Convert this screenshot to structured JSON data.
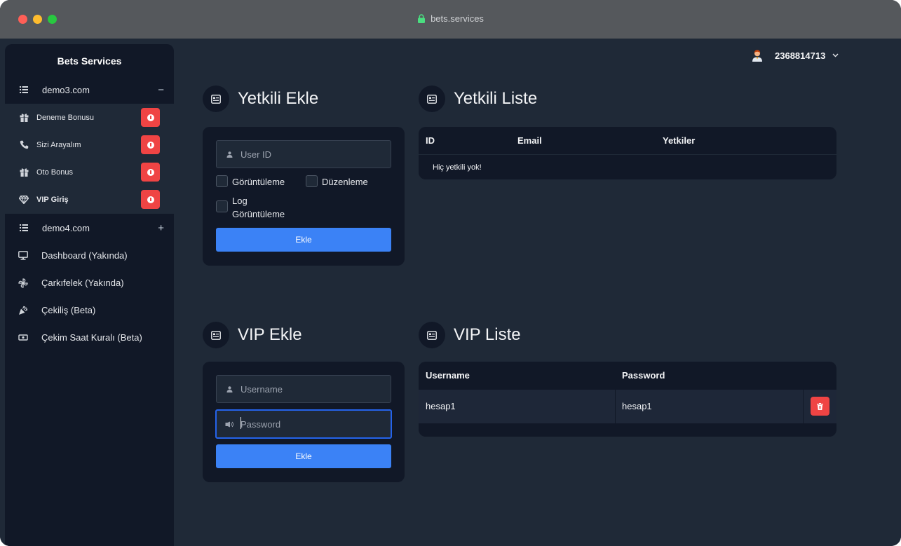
{
  "browser": {
    "url": "bets.services"
  },
  "sidebar": {
    "brand": "Bets Services",
    "site1": {
      "label": "demo3.com",
      "toggle": "−"
    },
    "site1_items": [
      {
        "label": "Deneme Bonusu",
        "icon": "gift-icon"
      },
      {
        "label": "Sizi Arayalım",
        "icon": "phone-icon"
      },
      {
        "label": "Oto Bonus",
        "icon": "gift-icon"
      },
      {
        "label": "VIP Giriş",
        "icon": "diamond-icon"
      }
    ],
    "site2": {
      "label": "demo4.com",
      "toggle": "+"
    },
    "menu": [
      {
        "label": "Dashboard (Yakında)",
        "icon": "monitor-icon"
      },
      {
        "label": "Çarkıfelek (Yakında)",
        "icon": "pinwheel-icon"
      },
      {
        "label": "Çekiliş (Beta)",
        "icon": "party-popper-icon"
      },
      {
        "label": "Çekim Saat Kuralı (Beta)",
        "icon": "money-icon"
      }
    ]
  },
  "header": {
    "user_id": "2368814713"
  },
  "yetkili_ekle": {
    "title": "Yetkili Ekle",
    "user_id_placeholder": "User ID",
    "perm_view": "Görüntüleme",
    "perm_edit": "Düzenleme",
    "perm_log_line1": "Log",
    "perm_log_line2": "Görüntüleme",
    "submit": "Ekle"
  },
  "yetkili_liste": {
    "title": "Yetkili Liste",
    "columns": [
      "ID",
      "Email",
      "Yetkiler"
    ],
    "empty": "Hiç yetkili yok!"
  },
  "vip_ekle": {
    "title": "VIP Ekle",
    "username_placeholder": "Username",
    "password_placeholder": "Password",
    "submit": "Ekle"
  },
  "vip_liste": {
    "title": "VIP Liste",
    "columns": [
      "Username",
      "Password"
    ],
    "rows": [
      {
        "username": "hesap1",
        "password": "hesap1"
      }
    ]
  },
  "colors": {
    "background": "#1f2937",
    "panel": "#111827",
    "primary": "#3b82f6",
    "danger": "#ef4444"
  }
}
